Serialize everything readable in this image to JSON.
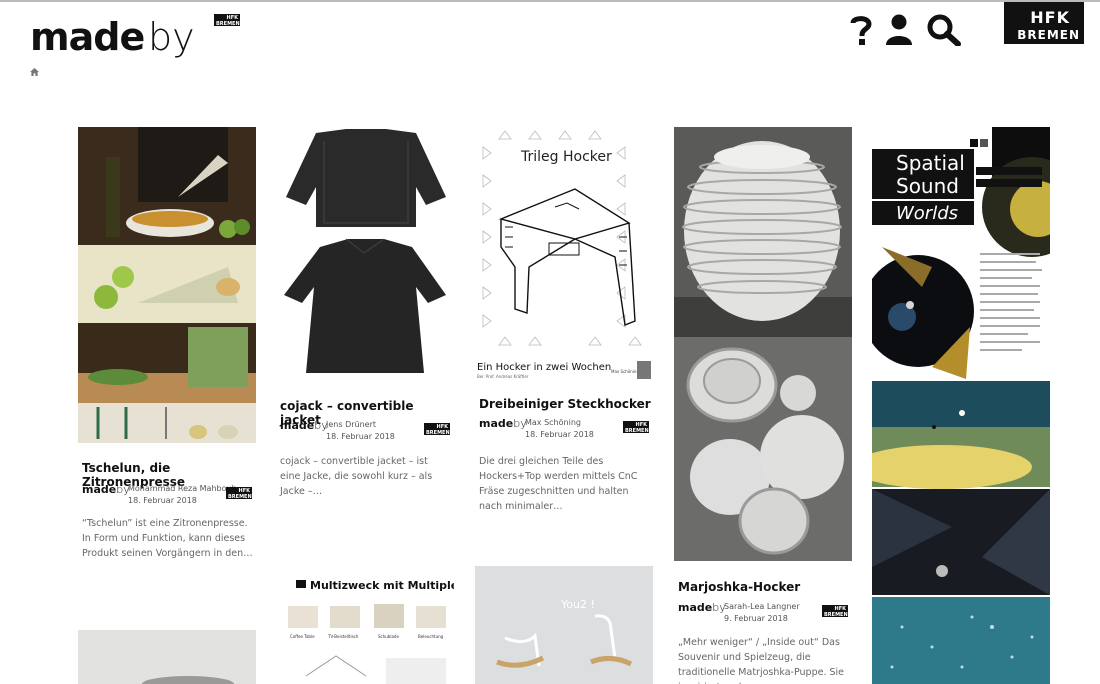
{
  "header": {
    "logo_made": "made",
    "logo_by": "by",
    "logo_mini_top": "HFK",
    "logo_mini_bottom": "BREMEN",
    "hfk_top": "HFK",
    "hfk_bottom": "BREMEN"
  },
  "cards": [
    {
      "title": "Tschelun, die Zitronenpresse",
      "madeby": "made",
      "madeby_by": "by",
      "author": "Mohammad Reza Mahboub",
      "date": "18. Februar 2018",
      "badge_top": "HFK",
      "badge_bottom": "BREMEN",
      "excerpt": "“Tschelun” ist eine Zitronenpresse. In Form und Funktion, kann dieses Produkt seinen Vorgängern in den…"
    },
    {
      "title": "cojack – convertible jacket",
      "madeby": "made",
      "madeby_by": "by",
      "author": "Jens Drünert",
      "date": "18. Februar 2018",
      "badge_top": "HFK",
      "badge_bottom": "BREMEN",
      "excerpt": "cojack – convertible jacket – ist eine Jacke, die sowohl kurz – als Jacke –…"
    },
    {
      "title": "Dreibeiniger Steckhocker",
      "madeby": "made",
      "madeby_by": "by",
      "author": "Max Schöning",
      "date": "18. Februar 2018",
      "badge_top": "HFK",
      "badge_bottom": "BREMEN",
      "excerpt": "Die drei gleichen Teile des Hockers+Top werden mittels CnC Fräse zugeschnitten und halten nach minimaler…",
      "image_title": "Trileg Hocker",
      "image_subtitle": "Ein Hocker in zwei Wochen",
      "image_caption": "Bei: Prof. Andreas Kräftler",
      "image_author": "Max Schöning"
    },
    {
      "title": "Marjoshka-Hocker",
      "madeby": "made",
      "madeby_by": "by",
      "author": "Sarah-Lea Langner",
      "date": "9. Februar 2018",
      "badge_top": "HFK",
      "badge_bottom": "BREMEN",
      "excerpt": "„Mehr weniger“ / „Inside out“ Das Souvenir und Spielzeug, die traditionelle Matrjoshka-Puppe. Sie inspiriert und…"
    },
    {
      "image_title_1": "Spatial",
      "image_title_2": "Sound",
      "image_title_3": "Worlds"
    },
    {
      "image_title": "Multizweck mit Multiplex.",
      "labels": [
        "Coffee Table",
        "TV-Beistelltisch",
        "Schublade",
        "Beleuchtung"
      ]
    },
    {
      "image_title": "You2 !"
    }
  ]
}
